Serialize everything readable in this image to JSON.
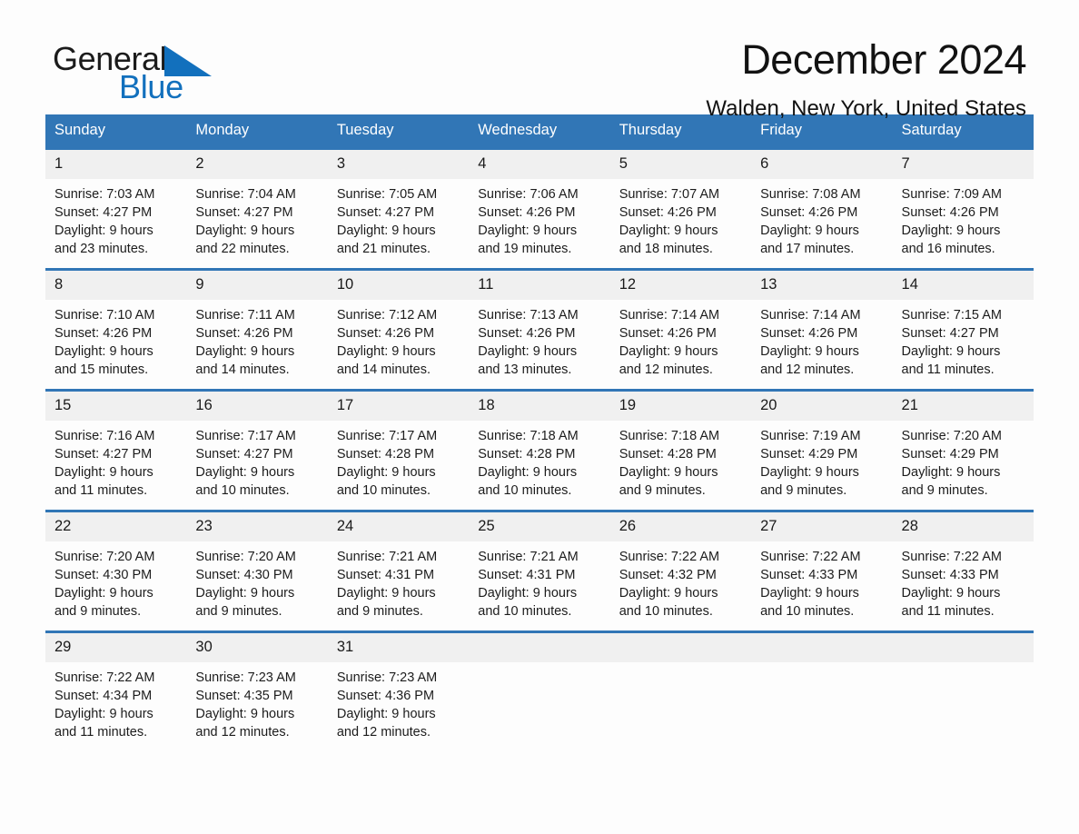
{
  "brand": {
    "name_part1": "General",
    "name_part2": "Blue",
    "mark": "triangle-logo"
  },
  "header": {
    "month_title": "December 2024",
    "location": "Walden, New York, United States"
  },
  "theme": {
    "accent": "#3176b6",
    "brand_blue": "#1270bd",
    "daynum_band": "#f0f0f0",
    "page_background": "#fdfdfd"
  },
  "calendar": {
    "weekday_headers": [
      "Sunday",
      "Monday",
      "Tuesday",
      "Wednesday",
      "Thursday",
      "Friday",
      "Saturday"
    ],
    "weeks": [
      [
        {
          "day": "1",
          "sunrise": "Sunrise: 7:03 AM",
          "sunset": "Sunset: 4:27 PM",
          "daylight_line1": "Daylight: 9 hours",
          "daylight_line2": "and 23 minutes."
        },
        {
          "day": "2",
          "sunrise": "Sunrise: 7:04 AM",
          "sunset": "Sunset: 4:27 PM",
          "daylight_line1": "Daylight: 9 hours",
          "daylight_line2": "and 22 minutes."
        },
        {
          "day": "3",
          "sunrise": "Sunrise: 7:05 AM",
          "sunset": "Sunset: 4:27 PM",
          "daylight_line1": "Daylight: 9 hours",
          "daylight_line2": "and 21 minutes."
        },
        {
          "day": "4",
          "sunrise": "Sunrise: 7:06 AM",
          "sunset": "Sunset: 4:26 PM",
          "daylight_line1": "Daylight: 9 hours",
          "daylight_line2": "and 19 minutes."
        },
        {
          "day": "5",
          "sunrise": "Sunrise: 7:07 AM",
          "sunset": "Sunset: 4:26 PM",
          "daylight_line1": "Daylight: 9 hours",
          "daylight_line2": "and 18 minutes."
        },
        {
          "day": "6",
          "sunrise": "Sunrise: 7:08 AM",
          "sunset": "Sunset: 4:26 PM",
          "daylight_line1": "Daylight: 9 hours",
          "daylight_line2": "and 17 minutes."
        },
        {
          "day": "7",
          "sunrise": "Sunrise: 7:09 AM",
          "sunset": "Sunset: 4:26 PM",
          "daylight_line1": "Daylight: 9 hours",
          "daylight_line2": "and 16 minutes."
        }
      ],
      [
        {
          "day": "8",
          "sunrise": "Sunrise: 7:10 AM",
          "sunset": "Sunset: 4:26 PM",
          "daylight_line1": "Daylight: 9 hours",
          "daylight_line2": "and 15 minutes."
        },
        {
          "day": "9",
          "sunrise": "Sunrise: 7:11 AM",
          "sunset": "Sunset: 4:26 PM",
          "daylight_line1": "Daylight: 9 hours",
          "daylight_line2": "and 14 minutes."
        },
        {
          "day": "10",
          "sunrise": "Sunrise: 7:12 AM",
          "sunset": "Sunset: 4:26 PM",
          "daylight_line1": "Daylight: 9 hours",
          "daylight_line2": "and 14 minutes."
        },
        {
          "day": "11",
          "sunrise": "Sunrise: 7:13 AM",
          "sunset": "Sunset: 4:26 PM",
          "daylight_line1": "Daylight: 9 hours",
          "daylight_line2": "and 13 minutes."
        },
        {
          "day": "12",
          "sunrise": "Sunrise: 7:14 AM",
          "sunset": "Sunset: 4:26 PM",
          "daylight_line1": "Daylight: 9 hours",
          "daylight_line2": "and 12 minutes."
        },
        {
          "day": "13",
          "sunrise": "Sunrise: 7:14 AM",
          "sunset": "Sunset: 4:26 PM",
          "daylight_line1": "Daylight: 9 hours",
          "daylight_line2": "and 12 minutes."
        },
        {
          "day": "14",
          "sunrise": "Sunrise: 7:15 AM",
          "sunset": "Sunset: 4:27 PM",
          "daylight_line1": "Daylight: 9 hours",
          "daylight_line2": "and 11 minutes."
        }
      ],
      [
        {
          "day": "15",
          "sunrise": "Sunrise: 7:16 AM",
          "sunset": "Sunset: 4:27 PM",
          "daylight_line1": "Daylight: 9 hours",
          "daylight_line2": "and 11 minutes."
        },
        {
          "day": "16",
          "sunrise": "Sunrise: 7:17 AM",
          "sunset": "Sunset: 4:27 PM",
          "daylight_line1": "Daylight: 9 hours",
          "daylight_line2": "and 10 minutes."
        },
        {
          "day": "17",
          "sunrise": "Sunrise: 7:17 AM",
          "sunset": "Sunset: 4:28 PM",
          "daylight_line1": "Daylight: 9 hours",
          "daylight_line2": "and 10 minutes."
        },
        {
          "day": "18",
          "sunrise": "Sunrise: 7:18 AM",
          "sunset": "Sunset: 4:28 PM",
          "daylight_line1": "Daylight: 9 hours",
          "daylight_line2": "and 10 minutes."
        },
        {
          "day": "19",
          "sunrise": "Sunrise: 7:18 AM",
          "sunset": "Sunset: 4:28 PM",
          "daylight_line1": "Daylight: 9 hours",
          "daylight_line2": "and 9 minutes."
        },
        {
          "day": "20",
          "sunrise": "Sunrise: 7:19 AM",
          "sunset": "Sunset: 4:29 PM",
          "daylight_line1": "Daylight: 9 hours",
          "daylight_line2": "and 9 minutes."
        },
        {
          "day": "21",
          "sunrise": "Sunrise: 7:20 AM",
          "sunset": "Sunset: 4:29 PM",
          "daylight_line1": "Daylight: 9 hours",
          "daylight_line2": "and 9 minutes."
        }
      ],
      [
        {
          "day": "22",
          "sunrise": "Sunrise: 7:20 AM",
          "sunset": "Sunset: 4:30 PM",
          "daylight_line1": "Daylight: 9 hours",
          "daylight_line2": "and 9 minutes."
        },
        {
          "day": "23",
          "sunrise": "Sunrise: 7:20 AM",
          "sunset": "Sunset: 4:30 PM",
          "daylight_line1": "Daylight: 9 hours",
          "daylight_line2": "and 9 minutes."
        },
        {
          "day": "24",
          "sunrise": "Sunrise: 7:21 AM",
          "sunset": "Sunset: 4:31 PM",
          "daylight_line1": "Daylight: 9 hours",
          "daylight_line2": "and 9 minutes."
        },
        {
          "day": "25",
          "sunrise": "Sunrise: 7:21 AM",
          "sunset": "Sunset: 4:31 PM",
          "daylight_line1": "Daylight: 9 hours",
          "daylight_line2": "and 10 minutes."
        },
        {
          "day": "26",
          "sunrise": "Sunrise: 7:22 AM",
          "sunset": "Sunset: 4:32 PM",
          "daylight_line1": "Daylight: 9 hours",
          "daylight_line2": "and 10 minutes."
        },
        {
          "day": "27",
          "sunrise": "Sunrise: 7:22 AM",
          "sunset": "Sunset: 4:33 PM",
          "daylight_line1": "Daylight: 9 hours",
          "daylight_line2": "and 10 minutes."
        },
        {
          "day": "28",
          "sunrise": "Sunrise: 7:22 AM",
          "sunset": "Sunset: 4:33 PM",
          "daylight_line1": "Daylight: 9 hours",
          "daylight_line2": "and 11 minutes."
        }
      ],
      [
        {
          "day": "29",
          "sunrise": "Sunrise: 7:22 AM",
          "sunset": "Sunset: 4:34 PM",
          "daylight_line1": "Daylight: 9 hours",
          "daylight_line2": "and 11 minutes."
        },
        {
          "day": "30",
          "sunrise": "Sunrise: 7:23 AM",
          "sunset": "Sunset: 4:35 PM",
          "daylight_line1": "Daylight: 9 hours",
          "daylight_line2": "and 12 minutes."
        },
        {
          "day": "31",
          "sunrise": "Sunrise: 7:23 AM",
          "sunset": "Sunset: 4:36 PM",
          "daylight_line1": "Daylight: 9 hours",
          "daylight_line2": "and 12 minutes."
        },
        {
          "day": "",
          "sunrise": "",
          "sunset": "",
          "daylight_line1": "",
          "daylight_line2": ""
        },
        {
          "day": "",
          "sunrise": "",
          "sunset": "",
          "daylight_line1": "",
          "daylight_line2": ""
        },
        {
          "day": "",
          "sunrise": "",
          "sunset": "",
          "daylight_line1": "",
          "daylight_line2": ""
        },
        {
          "day": "",
          "sunrise": "",
          "sunset": "",
          "daylight_line1": "",
          "daylight_line2": ""
        }
      ]
    ]
  }
}
